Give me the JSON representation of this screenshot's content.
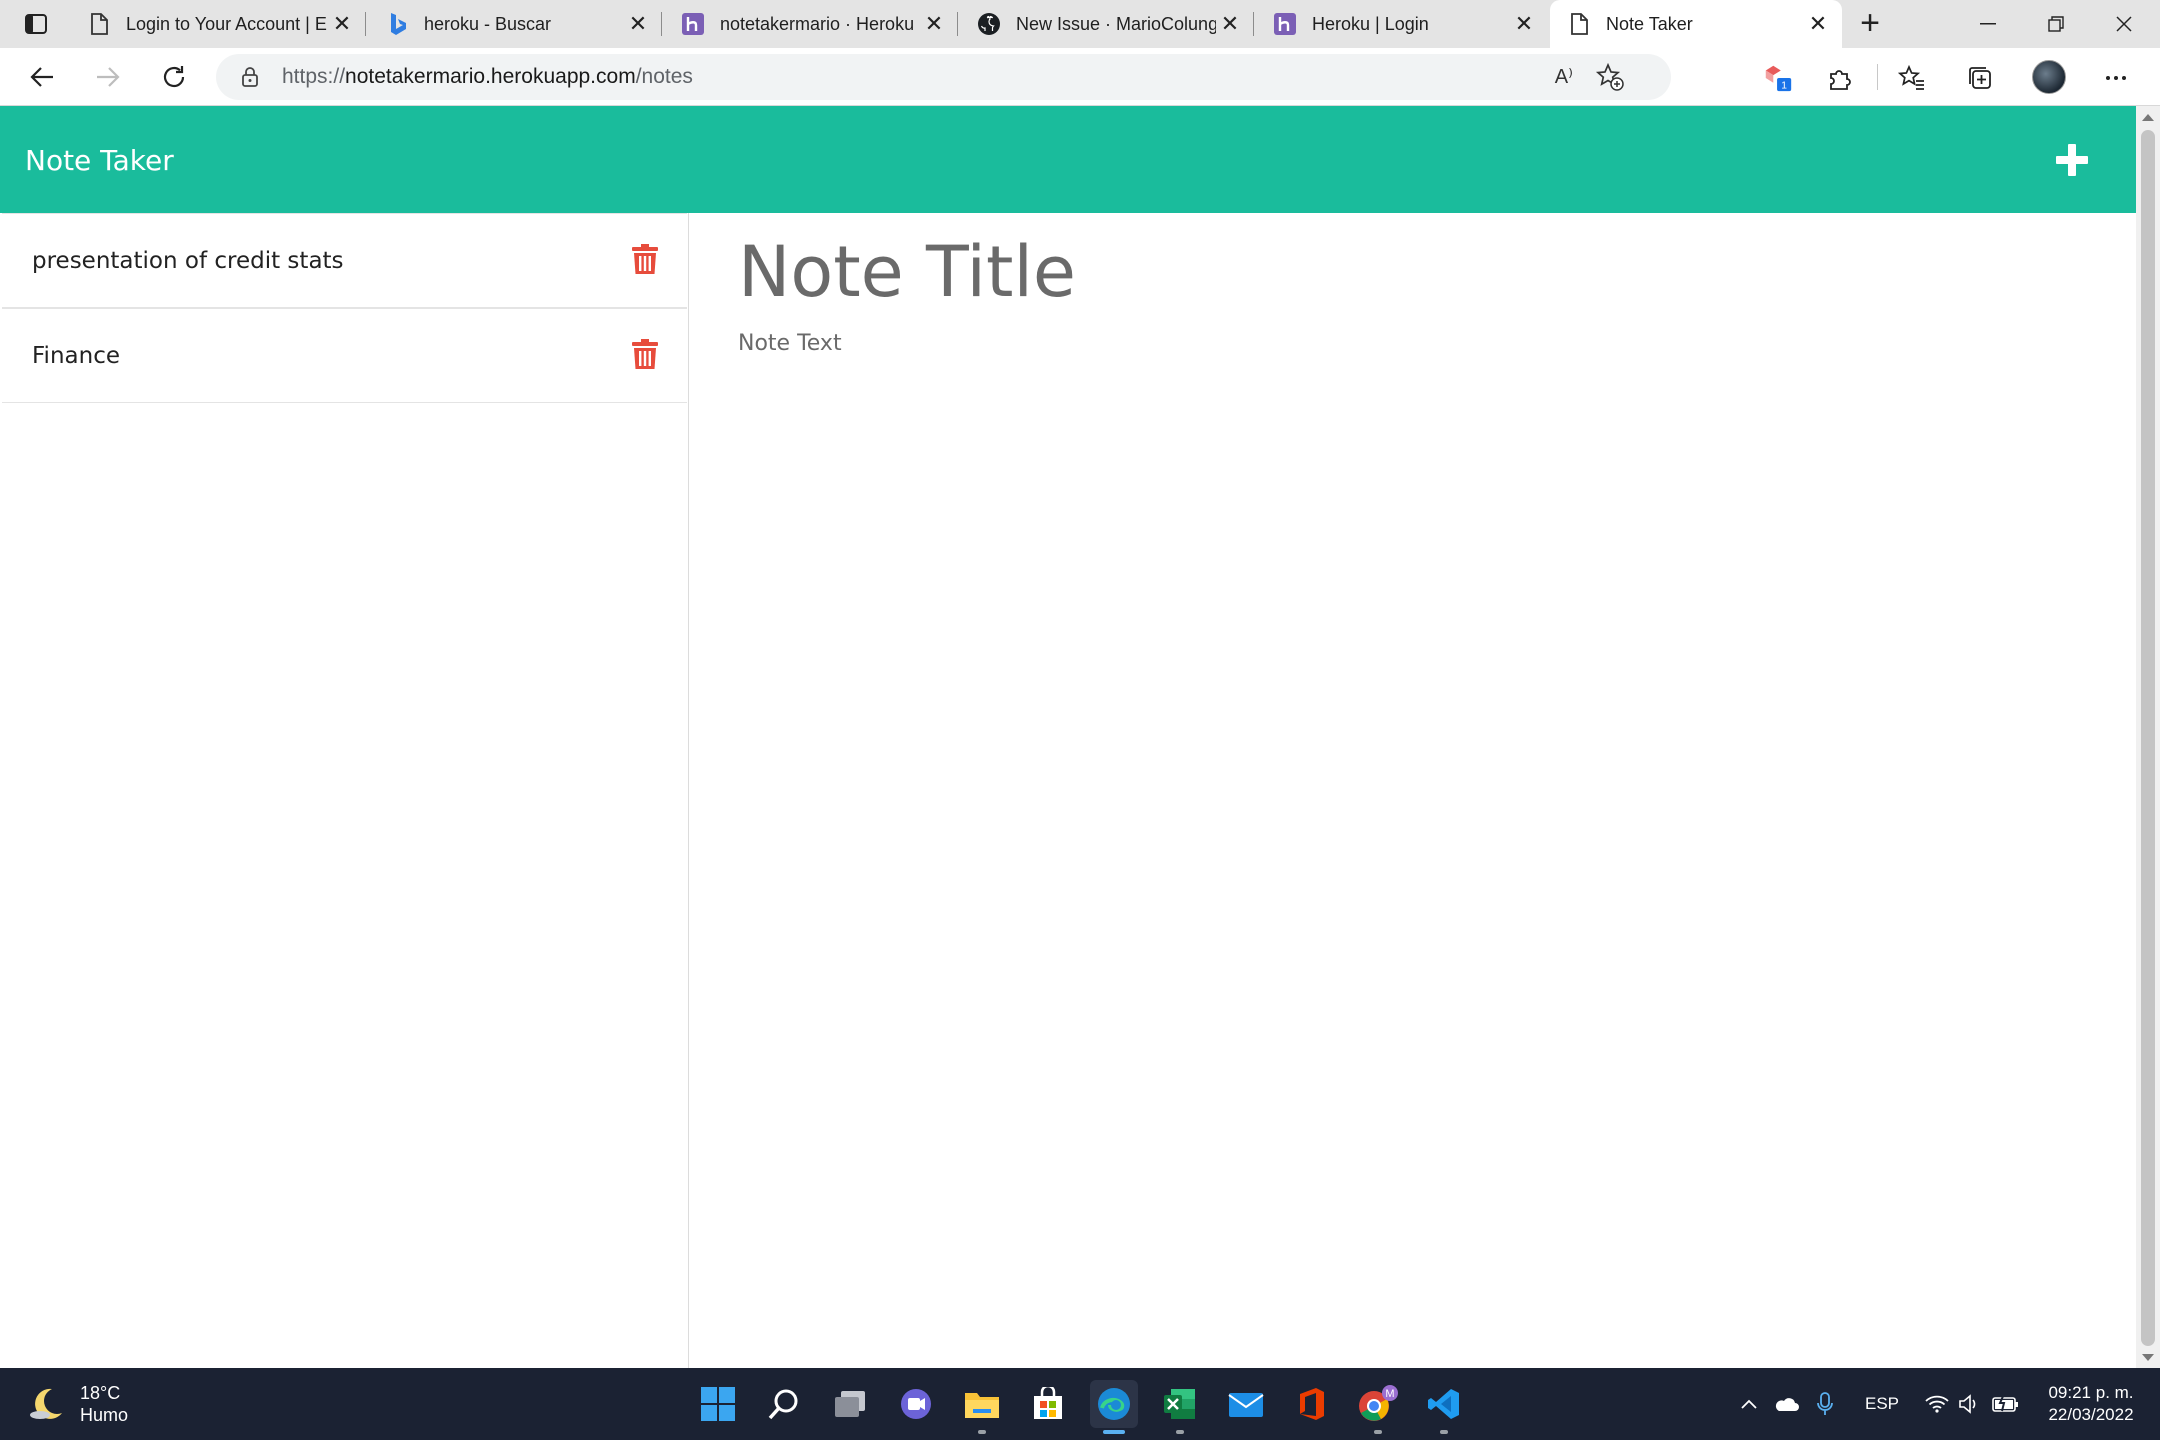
{
  "browser": {
    "tabs": [
      {
        "title": "Login to Your Account | E",
        "favicon": "page-icon",
        "active": false
      },
      {
        "title": "heroku - Buscar",
        "favicon": "bing-icon",
        "active": false
      },
      {
        "title": "notetakermario · Heroku",
        "favicon": "heroku-icon",
        "active": false
      },
      {
        "title": "New Issue · MarioColung",
        "favicon": "github-icon",
        "active": false
      },
      {
        "title": "Heroku | Login",
        "favicon": "heroku-icon",
        "active": false
      },
      {
        "title": "Note Taker",
        "favicon": "page-icon",
        "active": true
      }
    ],
    "url_prefix": "https://",
    "url_host": "notetakermario.herokuapp.com",
    "url_path": "/notes",
    "extension_badge": "1",
    "read_aloud_label": "A⁾"
  },
  "app": {
    "title": "Note Taker",
    "header_color": "#1abc9c",
    "notes": [
      {
        "title": "presentation of credit stats"
      },
      {
        "title": "Finance"
      }
    ],
    "editor": {
      "title_placeholder": "Note Title",
      "text_placeholder": "Note Text"
    },
    "accent_delete": "#e74c3c"
  },
  "taskbar": {
    "weather_temp": "18°C",
    "weather_condition": "Humo",
    "language": "ESP",
    "time": "09:21 p. m.",
    "date": "22/03/2022",
    "chrome_badge": "M"
  }
}
